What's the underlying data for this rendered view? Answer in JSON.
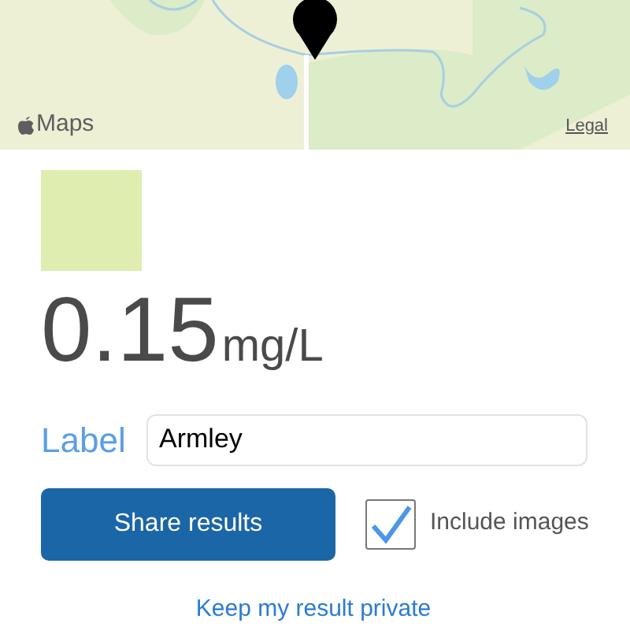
{
  "map": {
    "kind": "picture",
    "logo": "Maps",
    "legal": "Legal"
  },
  "result": {
    "color": "#dfedb0",
    "value": "0.15",
    "unit": "mg/L"
  },
  "label_field": {
    "label": "Label",
    "value": "Armley"
  },
  "share_button": "Share results",
  "include_images": {
    "label": "Include images",
    "checked": true
  },
  "private_link": "Keep my result private"
}
